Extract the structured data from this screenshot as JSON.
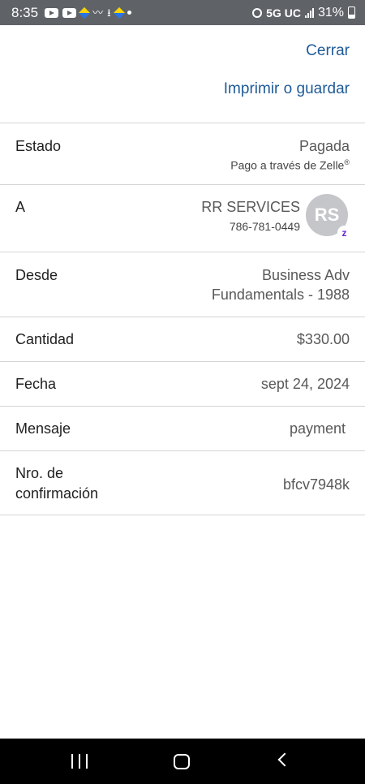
{
  "status_bar": {
    "time": "8:35",
    "network": "5G UC",
    "battery": "31%"
  },
  "actions": {
    "close_label": "Cerrar",
    "print_label": "Imprimir o guardar"
  },
  "details": {
    "estado_label": "Estado",
    "estado_value": "Pagada",
    "estado_sub": "Pago a través de Zelle",
    "estado_sub_mark": "®",
    "a_label": "A",
    "a_name": "RR SERVICES",
    "a_phone": "786-781-0449",
    "a_initials": "RS",
    "a_badge": "z",
    "desde_label": "Desde",
    "desde_line1": "Business Adv",
    "desde_line2": "Fundamentals - 1988",
    "cantidad_label": "Cantidad",
    "cantidad_value": "$330.00",
    "fecha_label": "Fecha",
    "fecha_value": "sept 24, 2024",
    "mensaje_label": "Mensaje",
    "mensaje_value": "payment",
    "confirmacion_label_1": "Nro. de",
    "confirmacion_label_2": "confirmación",
    "confirmacion_value": "bfcv7948k"
  },
  "icons": {
    "zelle_color": "#6d1ed4",
    "link_color": "#1e5a97"
  }
}
